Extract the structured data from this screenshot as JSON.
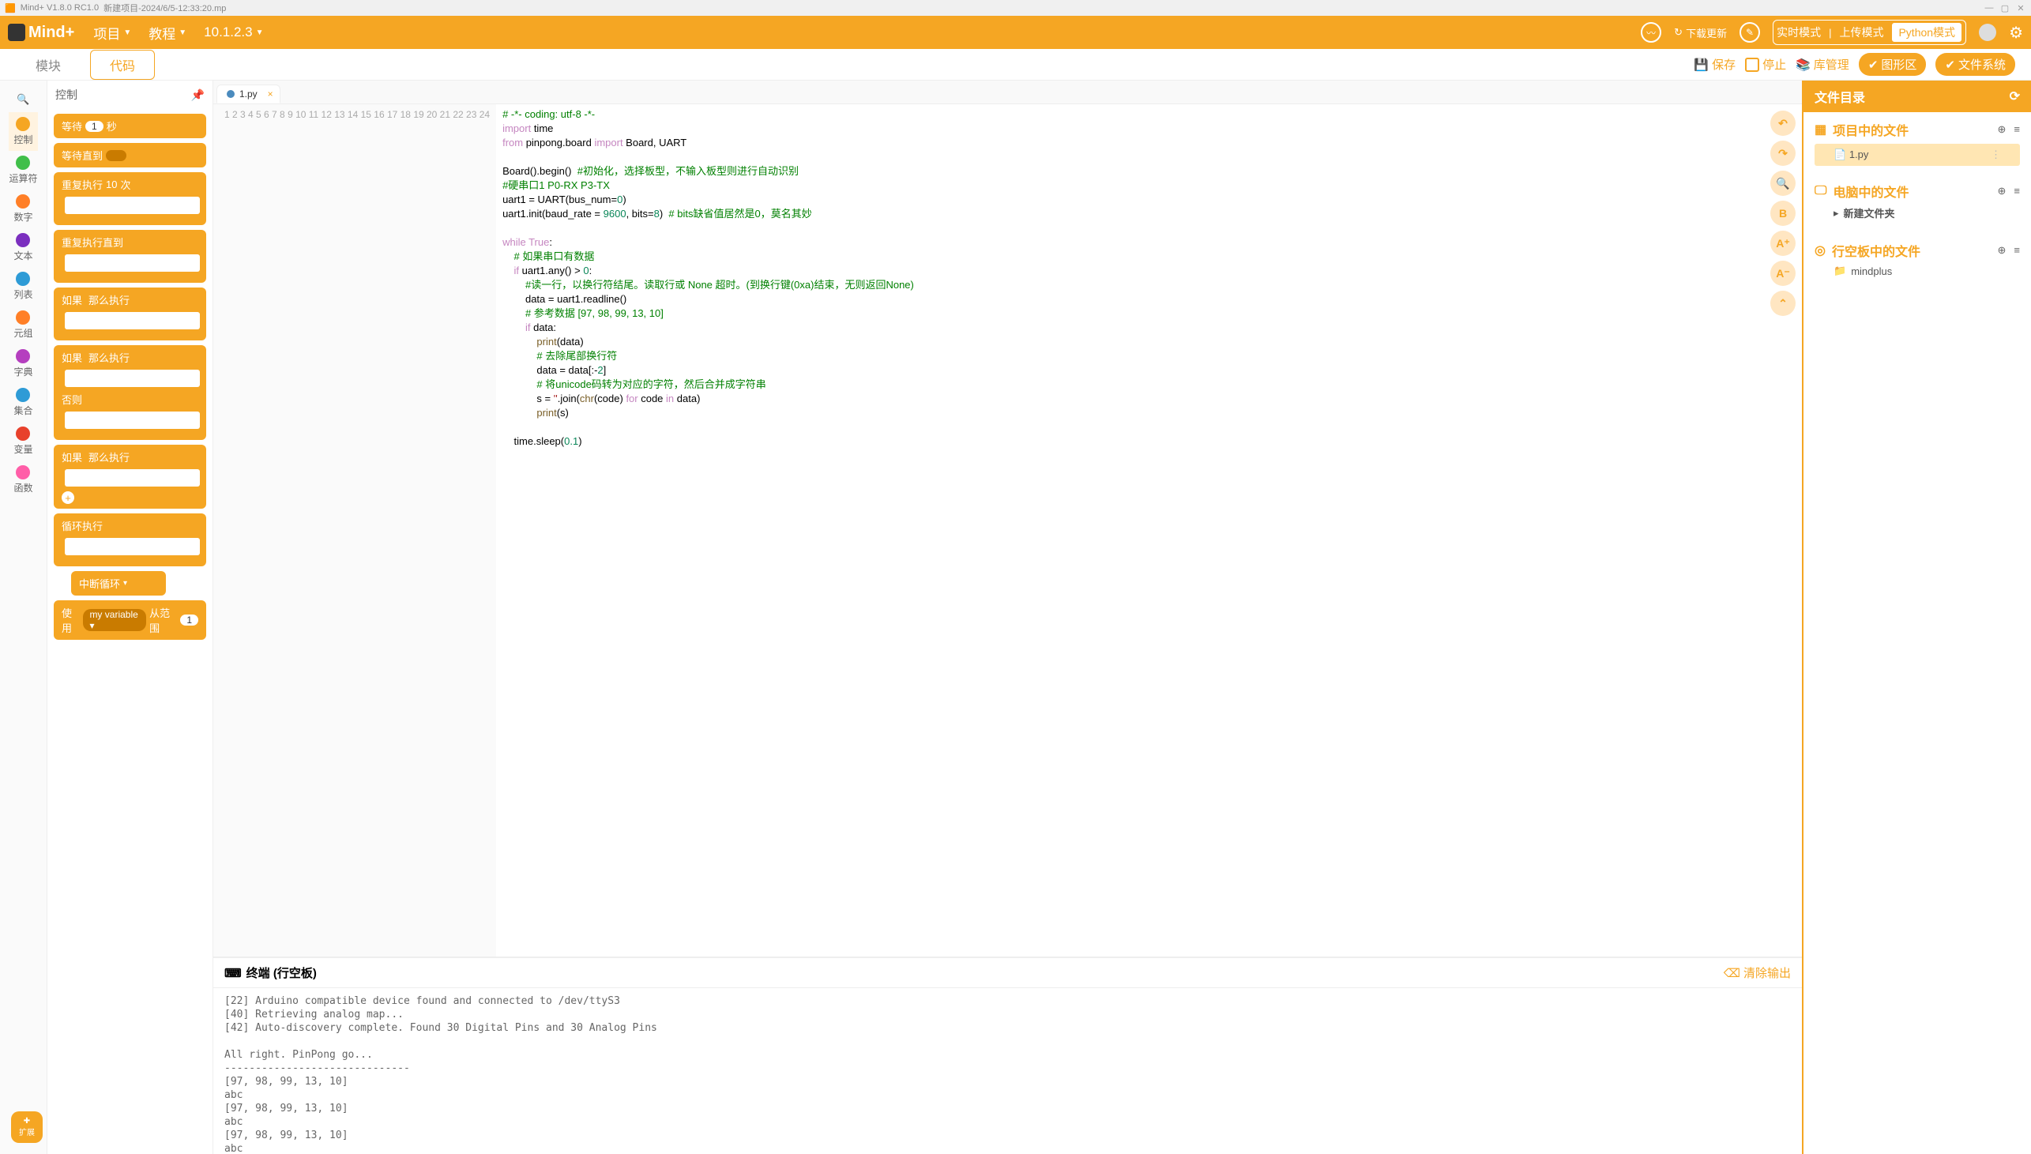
{
  "titlebar": {
    "app": "Mind+ V1.8.0 RC1.0",
    "file": "新建项目-2024/6/5-12:33:20.mp"
  },
  "top": {
    "logo": "Mind+",
    "menu1": "项目",
    "menu2": "教程",
    "version": "10.1.2.3",
    "update": "下载更新",
    "mode1": "实时模式",
    "mode2": "上传模式",
    "mode3": "Python模式"
  },
  "sec": {
    "tab1": "模块",
    "tab2": "代码",
    "save": "保存",
    "stop": "停止",
    "lib": "库管理",
    "graph": "图形区",
    "files": "文件系统"
  },
  "cats": [
    {
      "label": "控制",
      "color": "#f5a623",
      "active": true,
      "icon": "dot"
    },
    {
      "label": "运算符",
      "color": "#40bf4a",
      "icon": "dot"
    },
    {
      "label": "数字",
      "color": "#ff7f27",
      "icon": "sq"
    },
    {
      "label": "文本",
      "color": "#7b2fbf",
      "icon": "sq"
    },
    {
      "label": "列表",
      "color": "#2e9bd6",
      "icon": "sq"
    },
    {
      "label": "元组",
      "color": "#ff7f27",
      "icon": "lock"
    },
    {
      "label": "字典",
      "color": "#b53fbf",
      "icon": "sq"
    },
    {
      "label": "集合",
      "color": "#2e9bd6",
      "icon": "hex"
    },
    {
      "label": "变量",
      "color": "#e8412c",
      "icon": "dot"
    },
    {
      "label": "函数",
      "color": "#ff5ea8",
      "icon": "dot"
    }
  ],
  "blockHeader": "控制",
  "blocks": {
    "wait": "等待",
    "sec": "秒",
    "wait_num": "1",
    "wait_until": "等待直到",
    "repeat": "重复执行",
    "times": "次",
    "repeat_num": "10",
    "repeat_until": "重复执行直到",
    "if": "如果",
    "then": "那么执行",
    "else": "否则",
    "loop": "循环执行",
    "break": "中断循环",
    "use": "使用",
    "myvar": "my variable",
    "from": "从范围",
    "one": "1"
  },
  "editorTab": "1.py",
  "code_lines": [
    {
      "n": 1,
      "h": "<span class='com'># -*- coding: utf-8 -*-</span>"
    },
    {
      "n": 2,
      "h": "<span class='kw'>import</span> time"
    },
    {
      "n": 3,
      "h": "<span class='kw'>from</span> pinpong.board <span class='kw'>import</span> Board, UART"
    },
    {
      "n": 4,
      "h": ""
    },
    {
      "n": 5,
      "h": "Board().begin()  <span class='com'>#初始化，选择板型，不输入板型则进行自动识别</span>"
    },
    {
      "n": 6,
      "h": "<span class='com'>#硬串口1 P0-RX P3-TX</span>"
    },
    {
      "n": 7,
      "h": "uart1 = UART(bus_num=<span class='num'>0</span>)"
    },
    {
      "n": 8,
      "h": "uart1.init(baud_rate = <span class='num'>9600</span>, bits=<span class='num'>8</span>)  <span class='com'># bits缺省值居然是0，莫名其妙</span>"
    },
    {
      "n": 9,
      "h": ""
    },
    {
      "n": 10,
      "h": "<span class='kw'>while</span> <span class='kw'>True</span>:"
    },
    {
      "n": 11,
      "h": "    <span class='com'># 如果串口有数据</span>"
    },
    {
      "n": 12,
      "h": "    <span class='kw'>if</span> uart1.any() &gt; <span class='num'>0</span>:"
    },
    {
      "n": 13,
      "h": "        <span class='com'>#读一行，以换行符结尾。读取行或 None 超时。(到换行键(0xa)结束，无则返回None)</span>"
    },
    {
      "n": 14,
      "h": "        data = uart1.readline()"
    },
    {
      "n": 15,
      "h": "        <span class='com'># 参考数据 [97, 98, 99, 13, 10]</span>"
    },
    {
      "n": 16,
      "h": "        <span class='kw'>if</span> data:"
    },
    {
      "n": 17,
      "h": "            <span class='fn'>print</span>(data)"
    },
    {
      "n": 18,
      "h": "            <span class='com'># 去除尾部换行符</span>"
    },
    {
      "n": 19,
      "h": "            data = data[:-<span class='num'>2</span>]"
    },
    {
      "n": 20,
      "h": "            <span class='com'># 将unicode码转为对应的字符，然后合并成字符串</span>"
    },
    {
      "n": 21,
      "h": "            s = <span class='str'>''</span>.join(<span class='fn'>chr</span>(code) <span class='kw'>for</span> code <span class='kw'>in</span> data)"
    },
    {
      "n": 22,
      "h": "            <span class='fn'>print</span>(s)"
    },
    {
      "n": 23,
      "h": ""
    },
    {
      "n": 24,
      "h": "    time.sleep(<span class='num'>0.1</span>)"
    }
  ],
  "editor_tools": [
    "↶",
    "↷",
    "🔍",
    "B",
    "A⁺",
    "A⁻",
    "⌃"
  ],
  "term": {
    "title": "终端 (行空板)",
    "clear": "清除输出",
    "body": "[22] Arduino compatible device found and connected to /dev/ttyS3\n[40] Retrieving analog map...\n[42] Auto-discovery complete. Found 30 Digital Pins and 30 Analog Pins\n\nAll right. PinPong go...\n------------------------------\n[97, 98, 99, 13, 10]\nabc\n[97, 98, 99, 13, 10]\nabc\n[97, 98, 99, 13, 10]\nabc\n_"
  },
  "right": {
    "title": "文件目录",
    "sec1": "项目中的文件",
    "file1": "1.py",
    "sec2": "电脑中的文件",
    "folder": "新建文件夹",
    "sec3": "行空板中的文件",
    "folder2": "mindplus"
  },
  "ext": "扩展"
}
